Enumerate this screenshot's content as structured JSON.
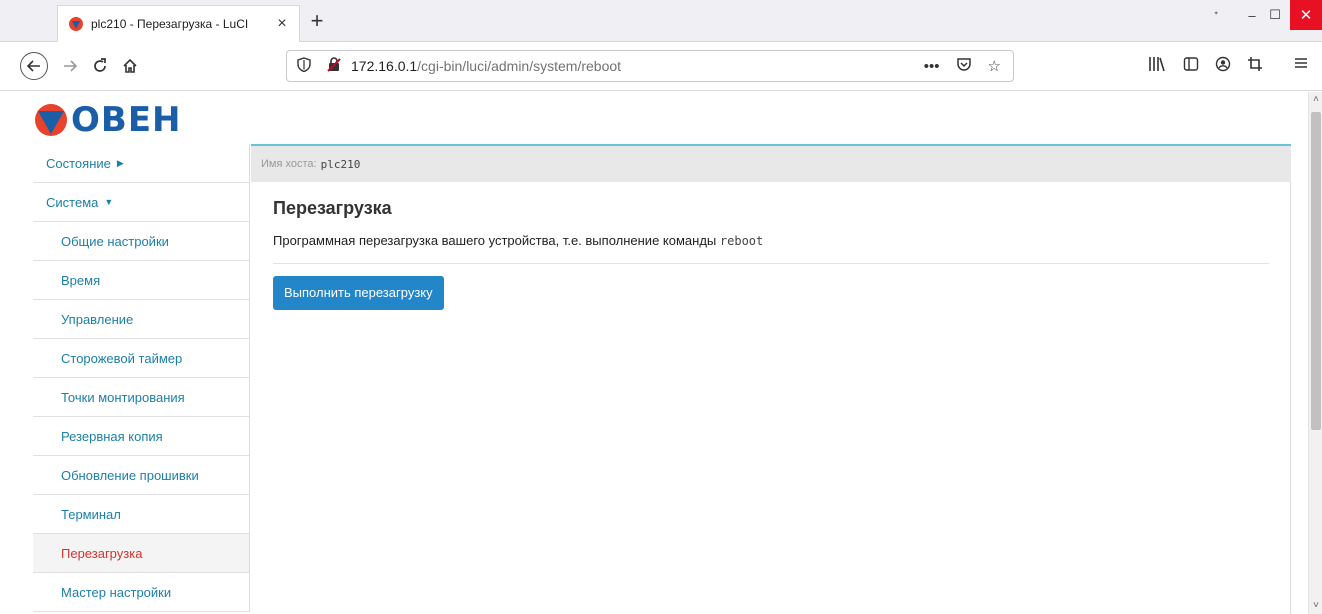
{
  "browser": {
    "tab_title": "plc210 - Перезагрузка - LuCI",
    "tab_close": "×",
    "new_tab": "+",
    "url_host": "172.16.0.1",
    "url_path": "/cgi-bin/luci/admin/system/reboot",
    "window_controls": {
      "restore": "ᐩ",
      "minimize": "–",
      "maximize": "☐",
      "close": "✕"
    }
  },
  "logo": {
    "text": "ОВЕН"
  },
  "sidebar": {
    "items": [
      {
        "label": "Состояние",
        "type": "top",
        "arrow": "▶"
      },
      {
        "label": "Система",
        "type": "top",
        "arrow": "▼"
      },
      {
        "label": "Общие настройки",
        "type": "sub"
      },
      {
        "label": "Время",
        "type": "sub"
      },
      {
        "label": "Управление",
        "type": "sub"
      },
      {
        "label": "Сторожевой таймер",
        "type": "sub"
      },
      {
        "label": "Точки монтирования",
        "type": "sub"
      },
      {
        "label": "Резервная копия",
        "type": "sub"
      },
      {
        "label": "Обновление прошивки",
        "type": "sub"
      },
      {
        "label": "Терминал",
        "type": "sub"
      },
      {
        "label": "Перезагрузка",
        "type": "sub",
        "active": true
      },
      {
        "label": "Мастер настройки",
        "type": "sub"
      }
    ]
  },
  "hostbar": {
    "label": "Имя хоста:",
    "hostname": "plc210"
  },
  "main": {
    "title": "Перезагрузка",
    "description": "Программная перезагрузка вашего устройства, т.е. выполнение команды",
    "command": "reboot",
    "button_label": "Выполнить перезагрузку"
  },
  "colors": {
    "link": "#1c7fa8",
    "active": "#d9322e",
    "button": "#2286c8",
    "accent_border": "#6bc3d6",
    "logo_blue": "#1a5ea8",
    "logo_red": "#e8412c"
  }
}
